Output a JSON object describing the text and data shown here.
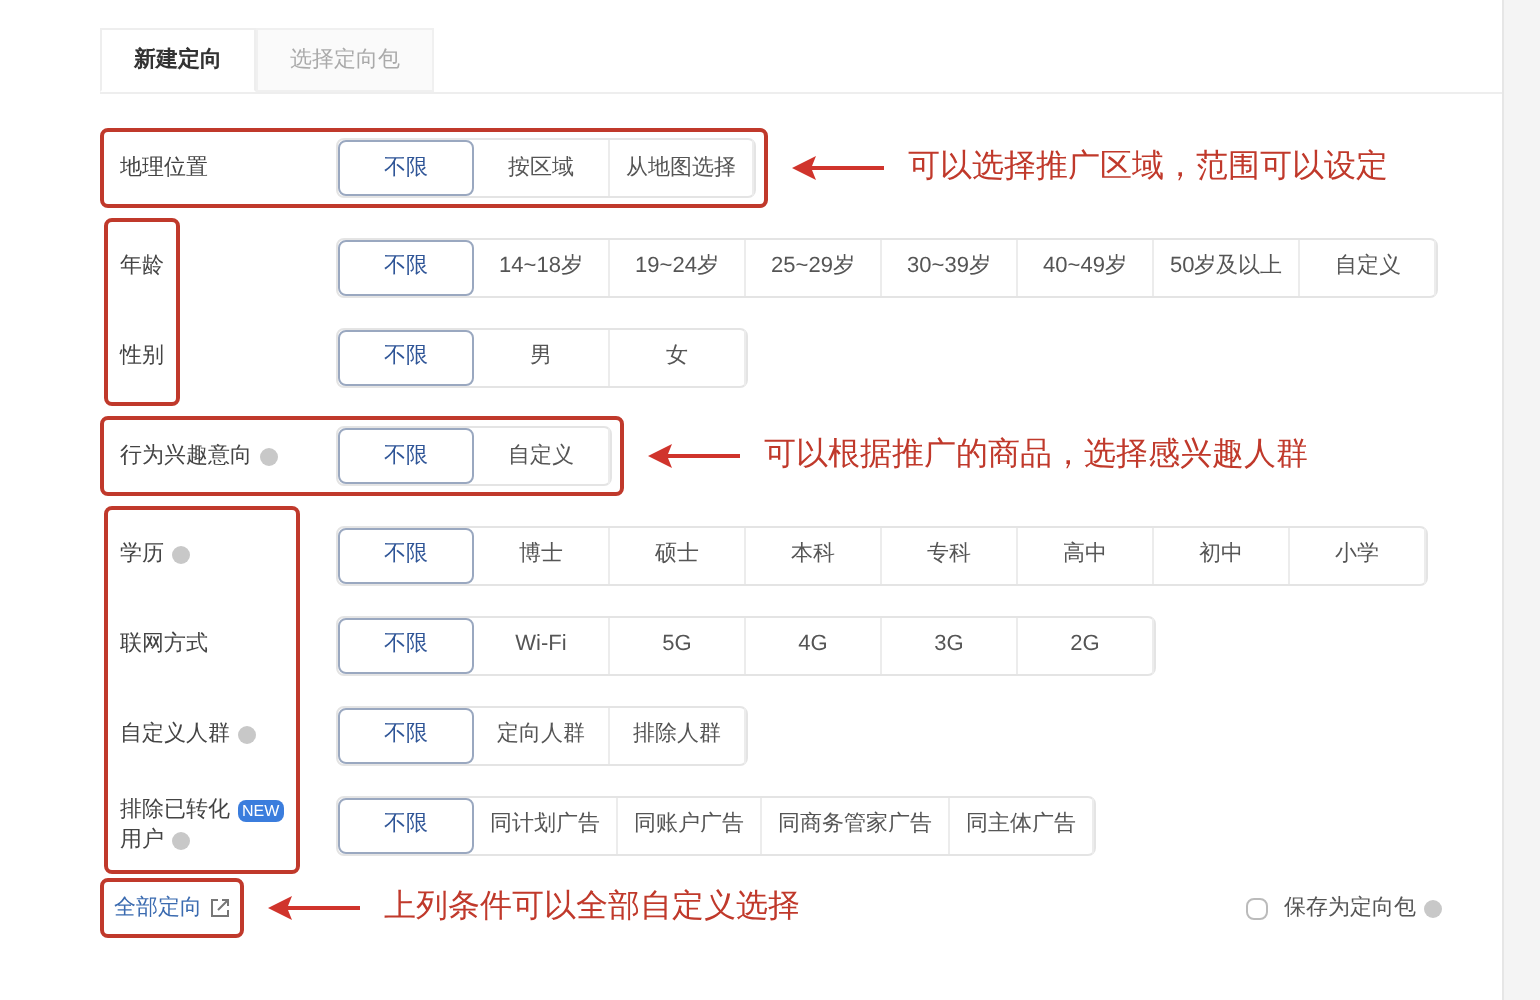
{
  "tabs": [
    {
      "label": "新建定向",
      "selected": true
    },
    {
      "label": "选择定向包",
      "selected": false
    }
  ],
  "sections": [
    {
      "kind": "row",
      "note": "可以选择推广区域，范围可以设定",
      "rows": [
        {
          "label_lines": [
            "地理位置"
          ],
          "help": false,
          "new_badge": null,
          "options": [
            {
              "label": "不限",
              "selected": true
            },
            {
              "label": "按区域",
              "selected": false
            },
            {
              "label": "从地图选择",
              "selected": false
            }
          ]
        }
      ]
    },
    {
      "kind": "labels",
      "rows": [
        {
          "label_lines": [
            "年龄"
          ],
          "help": false,
          "new_badge": null,
          "options": [
            {
              "label": "不限",
              "selected": true
            },
            {
              "label": "14~18岁",
              "selected": false
            },
            {
              "label": "19~24岁",
              "selected": false
            },
            {
              "label": "25~29岁",
              "selected": false
            },
            {
              "label": "30~39岁",
              "selected": false
            },
            {
              "label": "40~49岁",
              "selected": false
            },
            {
              "label": "50岁及以上",
              "selected": false
            },
            {
              "label": "自定义",
              "selected": false
            }
          ]
        },
        {
          "label_lines": [
            "性别"
          ],
          "help": false,
          "new_badge": null,
          "options": [
            {
              "label": "不限",
              "selected": true
            },
            {
              "label": "男",
              "selected": false
            },
            {
              "label": "女",
              "selected": false
            }
          ]
        }
      ]
    },
    {
      "kind": "row",
      "note": "可以根据推广的商品，选择感兴趣人群",
      "rows": [
        {
          "label_lines": [
            "行为兴趣意向"
          ],
          "help": true,
          "new_badge": null,
          "options": [
            {
              "label": "不限",
              "selected": true
            },
            {
              "label": "自定义",
              "selected": false
            }
          ]
        }
      ]
    },
    {
      "kind": "labels",
      "rows": [
        {
          "label_lines": [
            "学历"
          ],
          "help": true,
          "new_badge": null,
          "options": [
            {
              "label": "不限",
              "selected": true
            },
            {
              "label": "博士",
              "selected": false
            },
            {
              "label": "硕士",
              "selected": false
            },
            {
              "label": "本科",
              "selected": false
            },
            {
              "label": "专科",
              "selected": false
            },
            {
              "label": "高中",
              "selected": false
            },
            {
              "label": "初中",
              "selected": false
            },
            {
              "label": "小学",
              "selected": false
            }
          ]
        },
        {
          "label_lines": [
            "联网方式"
          ],
          "help": false,
          "new_badge": null,
          "options": [
            {
              "label": "不限",
              "selected": true
            },
            {
              "label": "Wi-Fi",
              "selected": false
            },
            {
              "label": "5G",
              "selected": false
            },
            {
              "label": "4G",
              "selected": false
            },
            {
              "label": "3G",
              "selected": false
            },
            {
              "label": "2G",
              "selected": false
            }
          ]
        },
        {
          "label_lines": [
            "自定义人群"
          ],
          "help": true,
          "new_badge": null,
          "options": [
            {
              "label": "不限",
              "selected": true
            },
            {
              "label": "定向人群",
              "selected": false
            },
            {
              "label": "排除人群",
              "selected": false
            }
          ]
        },
        {
          "label_lines": [
            "排除已转化",
            "用户"
          ],
          "help": true,
          "new_badge": "NEW",
          "options": [
            {
              "label": "不限",
              "selected": true
            },
            {
              "label": "同计划广告",
              "selected": false
            },
            {
              "label": "同账户广告",
              "selected": false
            },
            {
              "label": "同商务管家广告",
              "selected": false
            },
            {
              "label": "同主体广告",
              "selected": false
            }
          ]
        }
      ]
    }
  ],
  "footer": {
    "link": "全部定向",
    "note": "上列条件可以全部自定义选择",
    "save_checkbox": {
      "label": "保存为定向包",
      "checked": false,
      "help": true
    }
  }
}
